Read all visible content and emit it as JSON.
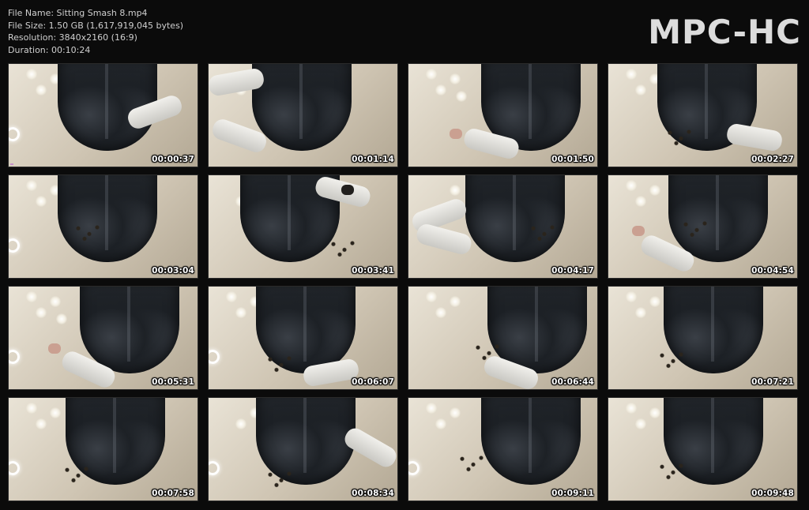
{
  "header": {
    "file_name": "File Name: Sitting Smash 8.mp4",
    "file_size": "File Size: 1.50 GB (1,617,919,045 bytes)",
    "resolution": "Resolution: 3840x2160 (16:9)",
    "duration": "Duration: 00:10:24"
  },
  "logo": "MPC-HC",
  "thumbnails": [
    {
      "time": "00:00:37"
    },
    {
      "time": "00:01:14"
    },
    {
      "time": "00:01:50"
    },
    {
      "time": "00:02:27"
    },
    {
      "time": "00:03:04"
    },
    {
      "time": "00:03:41"
    },
    {
      "time": "00:04:17"
    },
    {
      "time": "00:04:54"
    },
    {
      "time": "00:05:31"
    },
    {
      "time": "00:06:07"
    },
    {
      "time": "00:06:44"
    },
    {
      "time": "00:07:21"
    },
    {
      "time": "00:07:58"
    },
    {
      "time": "00:08:34"
    },
    {
      "time": "00:09:11"
    },
    {
      "time": "00:09:48"
    }
  ],
  "colors": {
    "background": "#0b0b0b",
    "text": "#cfcfcf",
    "logo": "#dcdcdc",
    "timestamp": "#ffffff"
  }
}
